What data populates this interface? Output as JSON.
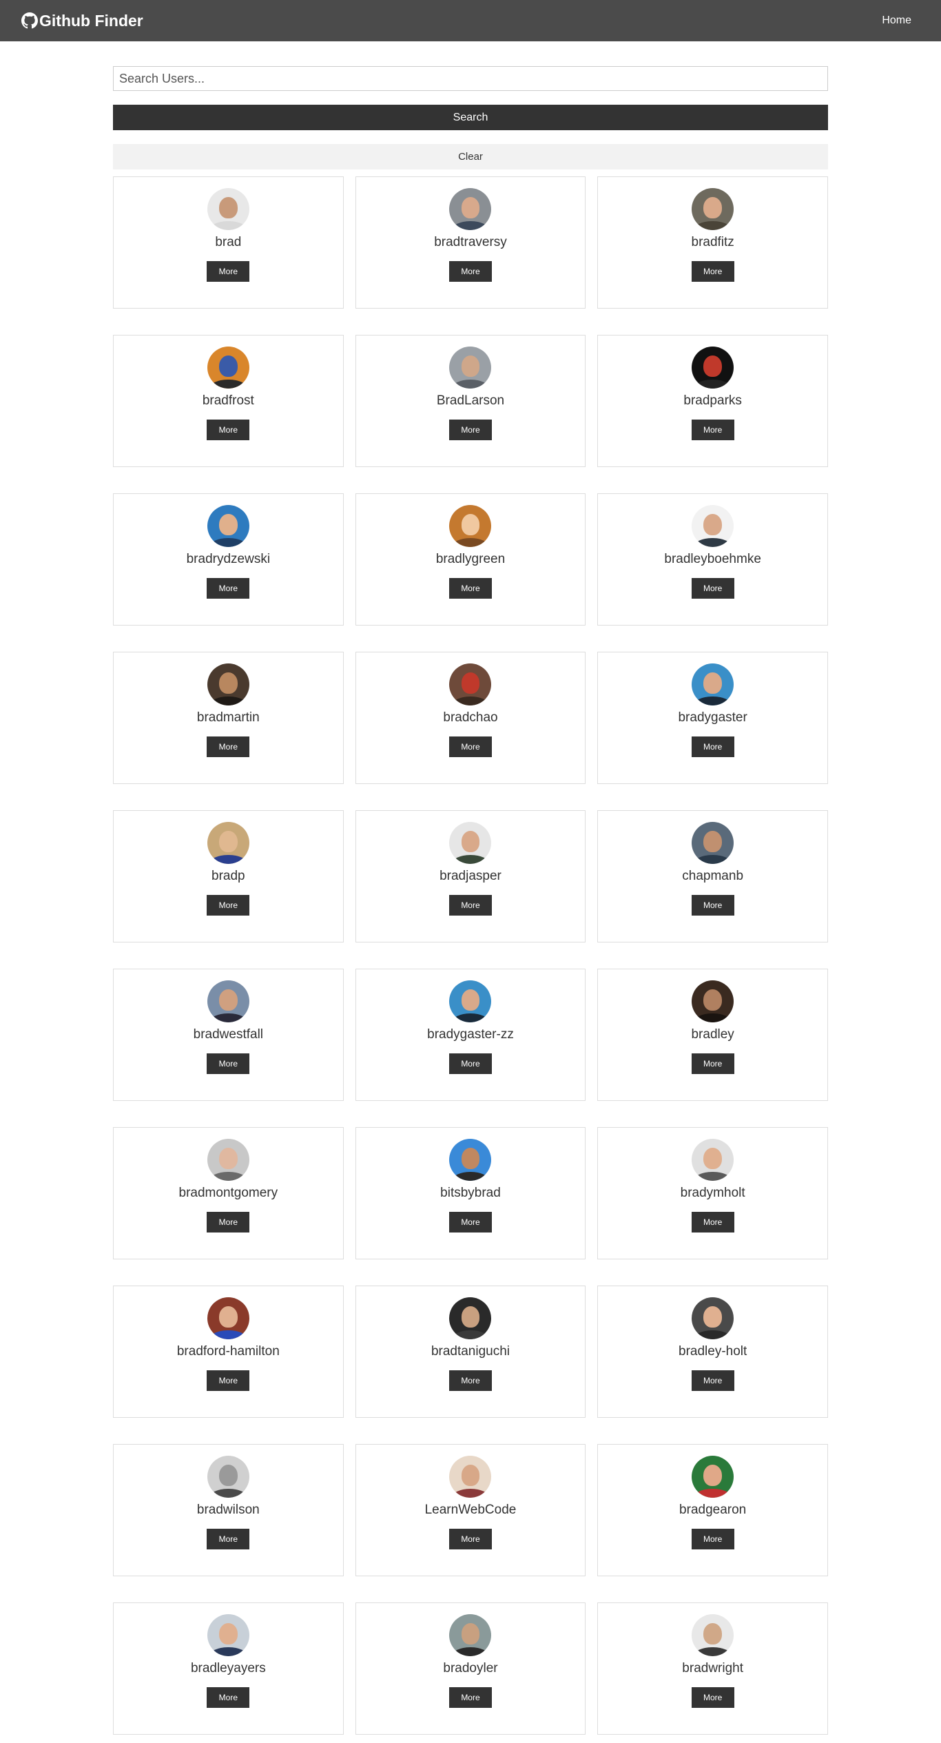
{
  "navbar": {
    "title": "Github Finder",
    "icon": "github-icon",
    "home_label": "Home"
  },
  "search": {
    "placeholder": "Search Users...",
    "value": "",
    "button_label": "Search",
    "clear_label": "Clear"
  },
  "colors": {
    "navbar_bg": "#4b4b4b",
    "button_dark": "#333333",
    "clear_bg": "#f2f2f2",
    "card_border": "#dddddd"
  },
  "users": [
    {
      "login": "brad",
      "more_label": "More",
      "avatar": {
        "bg": "#e8e8e8",
        "face": "#c89a7a",
        "body": "#d9d9d9"
      }
    },
    {
      "login": "bradtraversy",
      "more_label": "More",
      "avatar": {
        "bg": "#8a8f94",
        "face": "#d8a98c",
        "body": "#3d4a5c"
      }
    },
    {
      "login": "bradfitz",
      "more_label": "More",
      "avatar": {
        "bg": "#6e6a5e",
        "face": "#d9a98a",
        "body": "#4a4438"
      }
    },
    {
      "login": "bradfrost",
      "more_label": "More",
      "avatar": {
        "bg": "#d9862b",
        "face": "#3a5ba8",
        "body": "#2a2a2a"
      }
    },
    {
      "login": "BradLarson",
      "more_label": "More",
      "avatar": {
        "bg": "#9aa0a6",
        "face": "#cfa78a",
        "body": "#5a5f66"
      }
    },
    {
      "login": "bradparks",
      "more_label": "More",
      "avatar": {
        "bg": "#111111",
        "face": "#c0392b",
        "body": "#222222"
      }
    },
    {
      "login": "bradrydzewski",
      "more_label": "More",
      "avatar": {
        "bg": "#2e7bbf",
        "face": "#e0b08c",
        "body": "#1f3f66"
      }
    },
    {
      "login": "bradlygreen",
      "more_label": "More",
      "avatar": {
        "bg": "#c4792f",
        "face": "#f0c8a0",
        "body": "#7a4a22"
      }
    },
    {
      "login": "bradleyboehmke",
      "more_label": "More",
      "avatar": {
        "bg": "#f2f2f2",
        "face": "#d9a98a",
        "body": "#2f3a45"
      }
    },
    {
      "login": "bradmartin",
      "more_label": "More",
      "avatar": {
        "bg": "#4a3a2e",
        "face": "#b8875f",
        "body": "#1f1a16"
      }
    },
    {
      "login": "bradchao",
      "more_label": "More",
      "avatar": {
        "bg": "#6e4a3a",
        "face": "#c0392b",
        "body": "#3a2a20"
      }
    },
    {
      "login": "bradygaster",
      "more_label": "More",
      "avatar": {
        "bg": "#3a8fc8",
        "face": "#d9a98a",
        "body": "#1a2a3a"
      }
    },
    {
      "login": "bradp",
      "more_label": "More",
      "avatar": {
        "bg": "#c8a878",
        "face": "#e0b890",
        "body": "#2a3f8f"
      }
    },
    {
      "login": "bradjasper",
      "more_label": "More",
      "avatar": {
        "bg": "#e6e6e6",
        "face": "#d9a98a",
        "body": "#3a4a3a"
      }
    },
    {
      "login": "chapmanb",
      "more_label": "More",
      "avatar": {
        "bg": "#5a6a7a",
        "face": "#c09070",
        "body": "#2a3a4a"
      }
    },
    {
      "login": "bradwestfall",
      "more_label": "More",
      "avatar": {
        "bg": "#7a8ea8",
        "face": "#d0a080",
        "body": "#2a2a3a"
      }
    },
    {
      "login": "bradygaster-zz",
      "more_label": "More",
      "avatar": {
        "bg": "#3a8fc8",
        "face": "#d9a98a",
        "body": "#1a2a3a"
      }
    },
    {
      "login": "bradley",
      "more_label": "More",
      "avatar": {
        "bg": "#3a2a20",
        "face": "#b08060",
        "body": "#1a1410"
      }
    },
    {
      "login": "bradmontgomery",
      "more_label": "More",
      "avatar": {
        "bg": "#c8c8c8",
        "face": "#e0b8a0",
        "body": "#6a6a6a"
      }
    },
    {
      "login": "bitsbybrad",
      "more_label": "More",
      "avatar": {
        "bg": "#3a8ad8",
        "face": "#c08860",
        "body": "#2a2a2a"
      }
    },
    {
      "login": "bradymholt",
      "more_label": "More",
      "avatar": {
        "bg": "#e0e0e0",
        "face": "#e0b090",
        "body": "#5a5a5a"
      }
    },
    {
      "login": "bradford-hamilton",
      "more_label": "More",
      "avatar": {
        "bg": "#8a3a2a",
        "face": "#e0b090",
        "body": "#2a4ab8"
      }
    },
    {
      "login": "bradtaniguchi",
      "more_label": "More",
      "avatar": {
        "bg": "#2a2a2a",
        "face": "#c8a080",
        "body": "#3a3a3a"
      }
    },
    {
      "login": "bradley-holt",
      "more_label": "More",
      "avatar": {
        "bg": "#4a4a4a",
        "face": "#e0b090",
        "body": "#2a2a2a"
      }
    },
    {
      "login": "bradwilson",
      "more_label": "More",
      "avatar": {
        "bg": "#d0d0d0",
        "face": "#9a9a9a",
        "body": "#4a4a4a"
      }
    },
    {
      "login": "LearnWebCode",
      "more_label": "More",
      "avatar": {
        "bg": "#e8d8c8",
        "face": "#d8a888",
        "body": "#8a3a3a"
      }
    },
    {
      "login": "bradgearon",
      "more_label": "More",
      "avatar": {
        "bg": "#2a7a3a",
        "face": "#e0a888",
        "body": "#c03030"
      }
    },
    {
      "login": "bradleyayers",
      "more_label": "More",
      "avatar": {
        "bg": "#c8d0d8",
        "face": "#e0b090",
        "body": "#2a3a5a"
      }
    },
    {
      "login": "bradoyler",
      "more_label": "More",
      "avatar": {
        "bg": "#8a9a9a",
        "face": "#c8a080",
        "body": "#2a2a2a"
      }
    },
    {
      "login": "bradwright",
      "more_label": "More",
      "avatar": {
        "bg": "#e8e8e8",
        "face": "#d0a888",
        "body": "#3a3a3a"
      }
    }
  ]
}
